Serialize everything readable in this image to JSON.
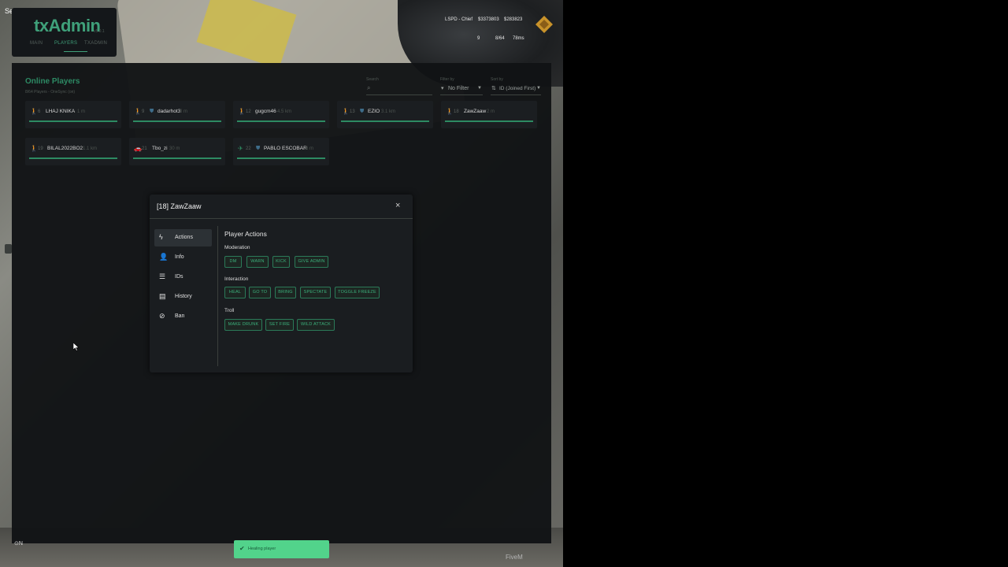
{
  "top_left_text": "Sefos",
  "header": {
    "logo": "txAdmin",
    "version": "v5.0.1",
    "tabs": [
      {
        "label": "MAIN"
      },
      {
        "label": "PLAYERS",
        "active": true
      },
      {
        "label": "TXADMIN"
      }
    ]
  },
  "hud": {
    "line1": "LSPD - Chief",
    "money1": "$3373803",
    "money2": "$283823",
    "stat1": "9",
    "stat2": "8/64",
    "stat3": "78ms"
  },
  "players_panel": {
    "title": "Online Players",
    "subtitle": "8/64 Players - OneSync (on)",
    "search": {
      "label": "Search",
      "value": ""
    },
    "filter": {
      "label": "Filter by",
      "value": "No Filter"
    },
    "sort": {
      "label": "Sort by",
      "value": "ID (Joined First)"
    },
    "players": [
      {
        "id": "6",
        "name": "LHAJ KNIKA",
        "dist": "1 m",
        "shield": false,
        "icon": "walk"
      },
      {
        "id": "9",
        "name": "dadarhot3",
        "dist": "3 m",
        "shield": true,
        "icon": "walk"
      },
      {
        "id": "12",
        "name": "gugcm46",
        "dist": "4.5 km",
        "shield": false,
        "icon": "walk"
      },
      {
        "id": "13",
        "name": "EZIO",
        "dist": "3.1 km",
        "shield": true,
        "icon": "walk"
      },
      {
        "id": "18",
        "name": "ZawZaaw",
        "dist": "2 m",
        "shield": false,
        "icon": "walk"
      },
      {
        "id": "19",
        "name": "BILAL2022BO2",
        "dist": "1.1 km",
        "shield": false,
        "icon": "walk"
      },
      {
        "id": "21",
        "name": "Tbo_zi",
        "dist": "30 m",
        "shield": false,
        "icon": "car"
      },
      {
        "id": "22",
        "name": "PABLO ESCOBAR",
        "dist": "6 m",
        "shield": true,
        "icon": "plane"
      }
    ]
  },
  "modal": {
    "title": "[18] ZawZaaw",
    "close": "×",
    "sidebar": [
      {
        "label": "Actions",
        "icon": "bolt",
        "active": true
      },
      {
        "label": "Info",
        "icon": "person"
      },
      {
        "label": "IDs",
        "icon": "list"
      },
      {
        "label": "History",
        "icon": "book"
      },
      {
        "label": "Ban",
        "icon": "ban"
      }
    ],
    "actions_title": "Player Actions",
    "sections": [
      {
        "label": "Moderation",
        "buttons": [
          "DM",
          "WARN",
          "KICK",
          "GIVE ADMIN"
        ]
      },
      {
        "label": "Interaction",
        "buttons": [
          "HEAL",
          "GO TO",
          "BRING",
          "SPECTATE",
          "TOGGLE FREEZE"
        ]
      },
      {
        "label": "Troll",
        "buttons": [
          "MAKE DRUNK",
          "SET FIRE",
          "WILD ATTACK"
        ]
      }
    ]
  },
  "toast": {
    "text": "Healing player"
  },
  "bottom_right": "FiveM",
  "colors": {
    "accent": "#2d8a62",
    "toast": "#52d38b",
    "panel": "#111315"
  }
}
